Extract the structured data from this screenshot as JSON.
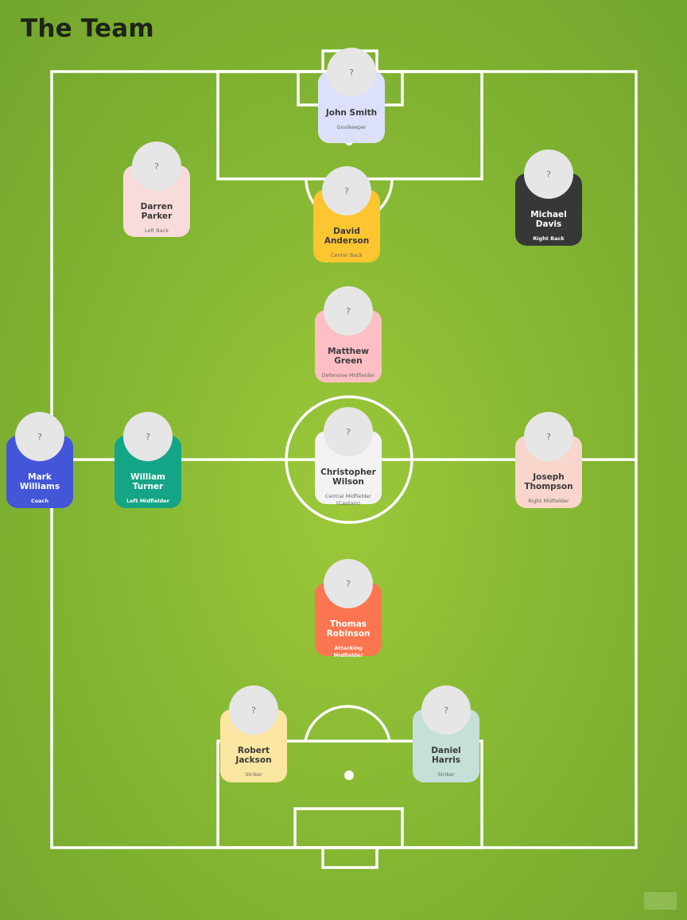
{
  "page": {
    "title": "The Team"
  },
  "avatar_placeholder": "?",
  "players": [
    {
      "id": "john-smith",
      "name": "John Smith",
      "role": "Goalkeeper",
      "color": "#dde0fb",
      "dark": false
    },
    {
      "id": "darren-parker",
      "name": "Darren Parker",
      "role": "Left Back",
      "color": "#f8dcdb",
      "dark": false
    },
    {
      "id": "david-anderson",
      "name": "David Anderson",
      "role": "Center Back",
      "color": "#fdc52f",
      "dark": false
    },
    {
      "id": "michael-davis",
      "name": "Michael Davis",
      "role": "Right Back",
      "color": "#373737",
      "dark": true
    },
    {
      "id": "matthew-green",
      "name": "Matthew Green",
      "role": "Defensive Midfielder",
      "color": "#fdbfc3",
      "dark": false
    },
    {
      "id": "mark-williams",
      "name": "Mark Williams",
      "role": "Coach",
      "color": "#4356d8",
      "dark": true
    },
    {
      "id": "william-turner",
      "name": "William Turner",
      "role": "Left Midfielder",
      "color": "#14a586",
      "dark": true
    },
    {
      "id": "christopher-wilson",
      "name": "Christopher Wilson",
      "role": "Central Midfielder (Captain)",
      "color": "#f3f3f3",
      "dark": false
    },
    {
      "id": "joseph-thompson",
      "name": "Joseph Thompson",
      "role": "Right Midfielder",
      "color": "#f8d6cb",
      "dark": false
    },
    {
      "id": "thomas-robinson",
      "name": "Thomas Robinson",
      "role": "Attacking Midfielder",
      "color": "#fb7650",
      "dark": true
    },
    {
      "id": "robert-jackson",
      "name": "Robert Jackson",
      "role": "Striker",
      "color": "#fbe6a1",
      "dark": false
    },
    {
      "id": "daniel-harris",
      "name": "Daniel Harris",
      "role": "Striker",
      "color": "#c4e0d9",
      "dark": false
    }
  ]
}
